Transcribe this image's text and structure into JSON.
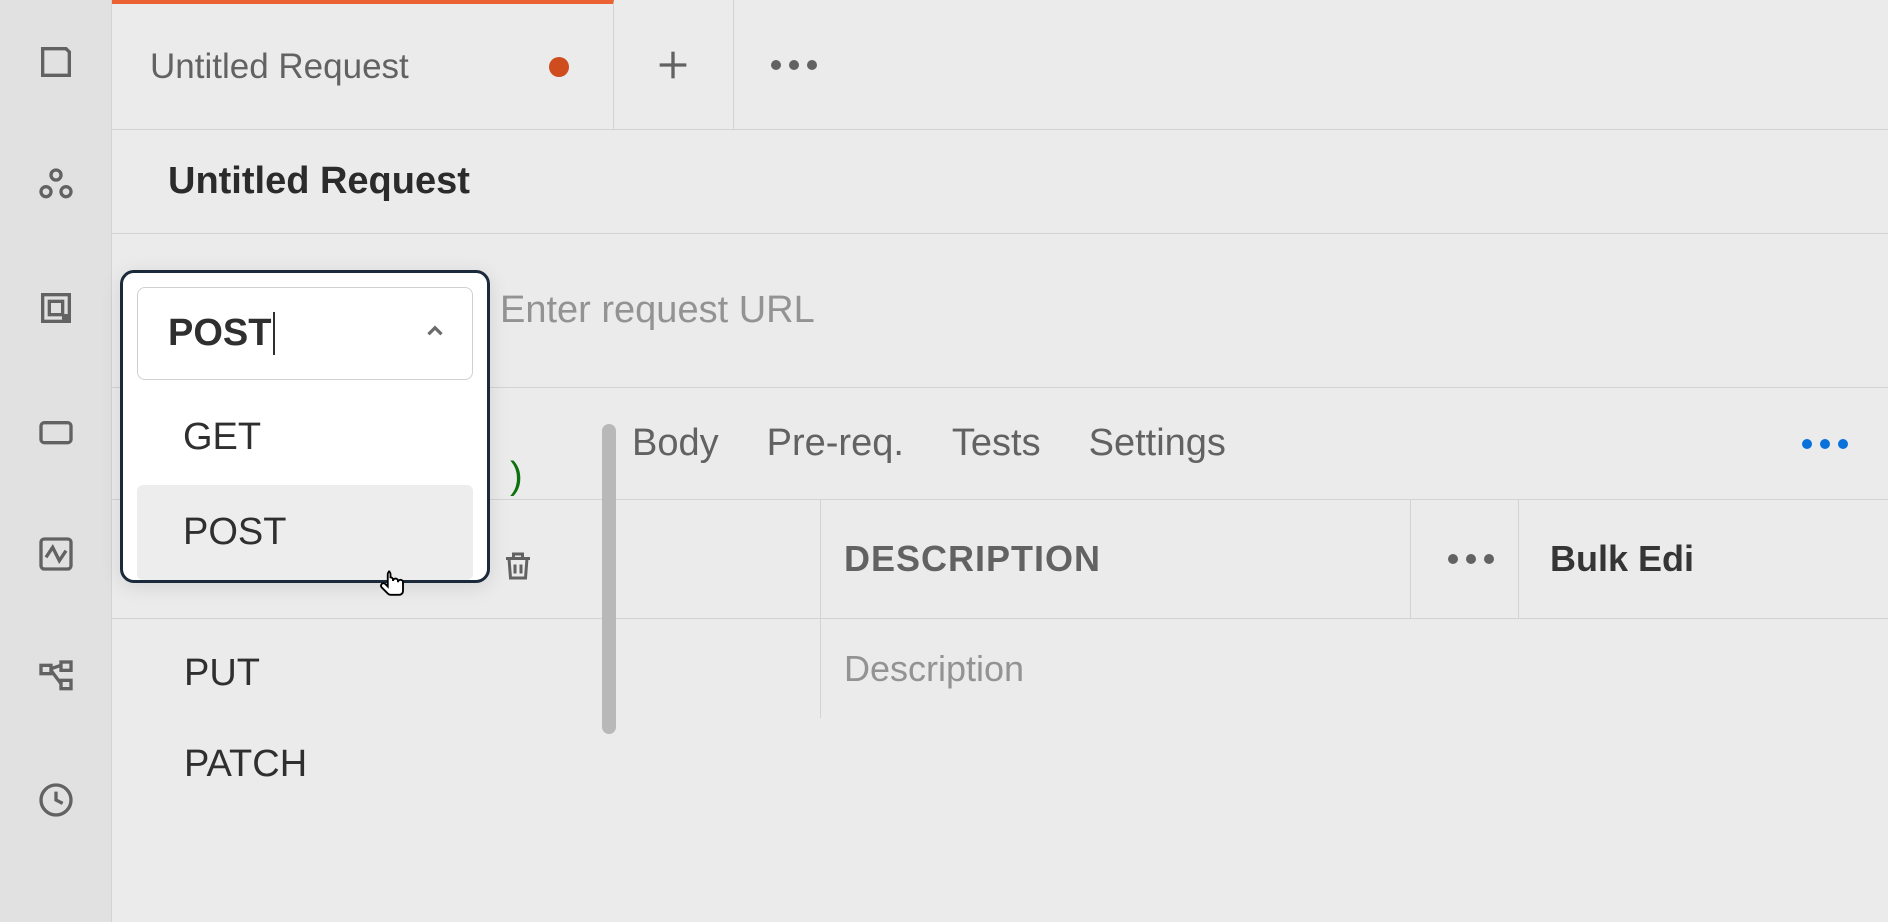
{
  "tab": {
    "label": "Untitled Request"
  },
  "title": "Untitled Request",
  "url_placeholder": "Enter request URL",
  "method_selected": "POST",
  "method_options_visible": [
    "GET",
    "POST"
  ],
  "method_options_below": [
    "PUT",
    "PATCH"
  ],
  "subtabs": {
    "body": "Body",
    "prereq": "Pre-req.",
    "tests": "Tests",
    "settings": "Settings"
  },
  "partial_paren": ")",
  "table": {
    "header_description": "DESCRIPTION",
    "bulk_edit": "Bulk Edi",
    "placeholder_description": "Description"
  }
}
